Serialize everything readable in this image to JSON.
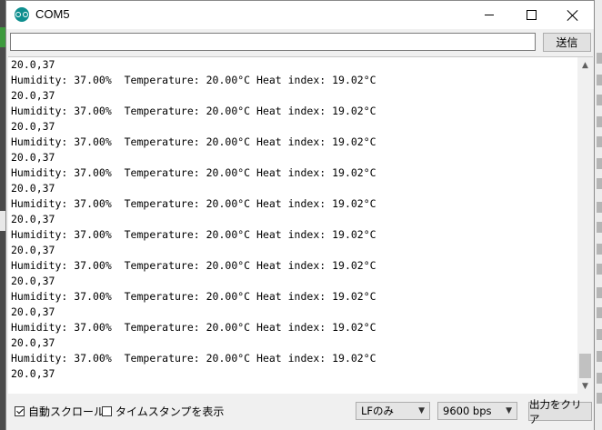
{
  "window": {
    "title": "COM5"
  },
  "send": {
    "input_value": "",
    "button_label": "送信"
  },
  "output": {
    "lines": [
      "20.0,37",
      "Humidity: 37.00%  Temperature: 20.00°C Heat index: 19.02°C",
      "20.0,37",
      "Humidity: 37.00%  Temperature: 20.00°C Heat index: 19.02°C",
      "20.0,37",
      "Humidity: 37.00%  Temperature: 20.00°C Heat index: 19.02°C",
      "20.0,37",
      "Humidity: 37.00%  Temperature: 20.00°C Heat index: 19.02°C",
      "20.0,37",
      "Humidity: 37.00%  Temperature: 20.00°C Heat index: 19.02°C",
      "20.0,37",
      "Humidity: 37.00%  Temperature: 20.00°C Heat index: 19.02°C",
      "20.0,37",
      "Humidity: 37.00%  Temperature: 20.00°C Heat index: 19.02°C",
      "20.0,37",
      "Humidity: 37.00%  Temperature: 20.00°C Heat index: 19.02°C",
      "20.0,37",
      "Humidity: 37.00%  Temperature: 20.00°C Heat index: 19.02°C",
      "20.0,37",
      "Humidity: 37.00%  Temperature: 20.00°C Heat index: 19.02°C",
      "20.0,37"
    ]
  },
  "footer": {
    "autoscroll_label": "自動スクロール",
    "autoscroll_checked": true,
    "timestamp_label": "タイムスタンプを表示",
    "timestamp_checked": false,
    "line_ending": "LFのみ",
    "baud_rate": "9600 bps",
    "clear_label": "出力をクリア"
  }
}
